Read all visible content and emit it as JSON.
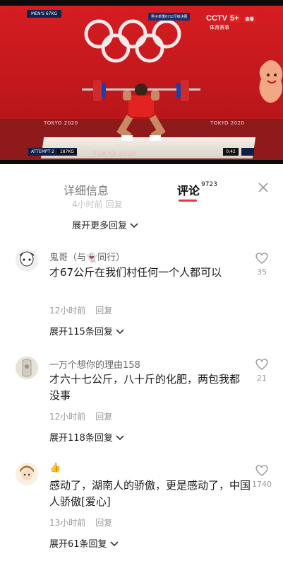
{
  "video": {
    "event_tag": "MEN'S 67KG",
    "caption": "男子举重67公斤级决赛",
    "channel": "CCTV",
    "channel_num": "5+",
    "live_badge": "直播",
    "channel_sub": "体育赛事",
    "venue_text": "TOKYO 2020",
    "attempt_label": "ATTEMPT 2",
    "weight": "187KG",
    "timer": "0:42"
  },
  "tabs": {
    "details": "详细信息",
    "comments": "评论",
    "comment_count": "9723"
  },
  "faded_meta": "4小时前   回复",
  "more_replies": "展开更多回复",
  "comments": [
    {
      "user": "鬼哥（与👻同行）",
      "text": "才67公斤在我们村任何一个人都可以",
      "time": "12小时前",
      "reply": "回复",
      "likes": "35",
      "expand": "展开115条回复"
    },
    {
      "user": "一万个想你的理由158",
      "text": "才六十七公斤，八十斤的化肥，两包我都没事",
      "time": "12小时前",
      "reply": "回复",
      "likes": "21",
      "expand": "展开118条回复"
    },
    {
      "user": "👍",
      "text": "感动了，湖南人的骄傲，更是感动了，中国人骄傲[爱心]",
      "time": "13小时前",
      "reply": "回复",
      "likes": "1740",
      "expand": "展开61条回复"
    }
  ]
}
